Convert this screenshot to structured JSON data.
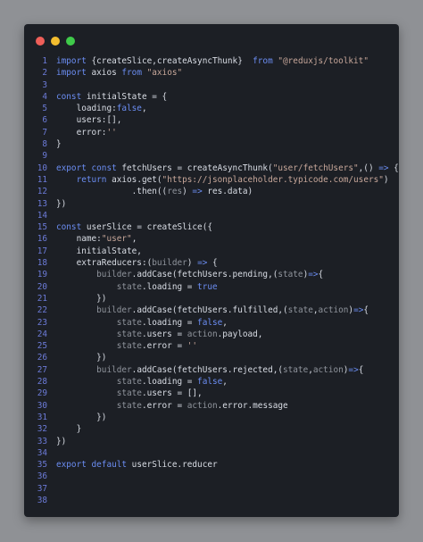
{
  "window": {
    "dots": [
      {
        "name": "close",
        "color": "#ef5f59"
      },
      {
        "name": "minimize",
        "color": "#f4bd2f"
      },
      {
        "name": "maximize",
        "color": "#3fca4a"
      }
    ]
  },
  "colors": {
    "keyword": "#6b8df2",
    "identifier": "#d9dde5",
    "string": "#c7a79a",
    "param": "#b5bac3",
    "line_number": "#6c7bd8",
    "background": "#1c1f25",
    "page_background": "#8f9195"
  },
  "code": {
    "lines": [
      {
        "n": "1",
        "tokens": [
          [
            "kw",
            "import "
          ],
          [
            "id",
            "{createSlice,createAsyncThunk}  "
          ],
          [
            "kw",
            "from "
          ],
          [
            "str",
            "\"@reduxjs/toolkit\""
          ]
        ]
      },
      {
        "n": "2",
        "tokens": [
          [
            "kw",
            "import "
          ],
          [
            "id",
            "axios "
          ],
          [
            "kw",
            "from "
          ],
          [
            "str",
            "\"axios\""
          ]
        ]
      },
      {
        "n": "3",
        "tokens": []
      },
      {
        "n": "4",
        "tokens": [
          [
            "kw",
            "const "
          ],
          [
            "id",
            "initialState = {"
          ]
        ]
      },
      {
        "n": "5",
        "tokens": [
          [
            "id",
            "    loading:"
          ],
          [
            "kw",
            "false"
          ],
          [
            "id",
            ","
          ]
        ]
      },
      {
        "n": "6",
        "tokens": [
          [
            "id",
            "    users:[],"
          ]
        ]
      },
      {
        "n": "7",
        "tokens": [
          [
            "id",
            "    error:"
          ],
          [
            "str",
            "''"
          ]
        ]
      },
      {
        "n": "8",
        "tokens": [
          [
            "id",
            "}"
          ]
        ]
      },
      {
        "n": "9",
        "tokens": []
      },
      {
        "n": "10",
        "tokens": [
          [
            "kw",
            "export const "
          ],
          [
            "id",
            "fetchUsers = createAsyncThunk("
          ],
          [
            "str",
            "\"user/fetchUsers\""
          ],
          [
            "id",
            ",() "
          ],
          [
            "kw",
            "=> "
          ],
          [
            "id",
            "{"
          ]
        ]
      },
      {
        "n": "11",
        "tokens": [
          [
            "kw",
            "    return "
          ],
          [
            "id",
            "axios.get("
          ],
          [
            "str",
            "\"https://jsonplaceholder.typicode.com/users\""
          ],
          [
            "id",
            ")"
          ]
        ]
      },
      {
        "n": "12",
        "tokens": [
          [
            "id",
            "               .then(("
          ],
          [
            "param",
            "res"
          ],
          [
            "id",
            ") "
          ],
          [
            "kw",
            "=> "
          ],
          [
            "id",
            "res.data)"
          ]
        ]
      },
      {
        "n": "13",
        "tokens": [
          [
            "id",
            "})"
          ]
        ]
      },
      {
        "n": "14",
        "tokens": []
      },
      {
        "n": "15",
        "tokens": [
          [
            "kw",
            "const "
          ],
          [
            "id",
            "userSlice = createSlice({"
          ]
        ]
      },
      {
        "n": "16",
        "tokens": [
          [
            "id",
            "    name:"
          ],
          [
            "str",
            "\"user\""
          ],
          [
            "id",
            ","
          ]
        ]
      },
      {
        "n": "17",
        "tokens": [
          [
            "id",
            "    initialState,"
          ]
        ]
      },
      {
        "n": "18",
        "tokens": [
          [
            "id",
            "    extraReducers:("
          ],
          [
            "param",
            "builder"
          ],
          [
            "id",
            ") "
          ],
          [
            "kw",
            "=> "
          ],
          [
            "id",
            "{"
          ]
        ]
      },
      {
        "n": "19",
        "tokens": [
          [
            "param",
            "        builder"
          ],
          [
            "id",
            ".addCase(fetchUsers.pending,("
          ],
          [
            "param",
            "state"
          ],
          [
            "id",
            ")"
          ],
          [
            "kw",
            "=>"
          ],
          [
            "id",
            "{"
          ]
        ]
      },
      {
        "n": "20",
        "tokens": [
          [
            "param",
            "            state"
          ],
          [
            "id",
            ".loading = "
          ],
          [
            "kw",
            "true"
          ]
        ]
      },
      {
        "n": "21",
        "tokens": [
          [
            "id",
            "        })"
          ]
        ]
      },
      {
        "n": "22",
        "tokens": [
          [
            "param",
            "        builder"
          ],
          [
            "id",
            ".addCase(fetchUsers.fulfilled,("
          ],
          [
            "param",
            "state"
          ],
          [
            "id",
            ","
          ],
          [
            "param",
            "action"
          ],
          [
            "id",
            ")"
          ],
          [
            "kw",
            "=>"
          ],
          [
            "id",
            "{"
          ]
        ]
      },
      {
        "n": "23",
        "tokens": [
          [
            "param",
            "            state"
          ],
          [
            "id",
            ".loading = "
          ],
          [
            "kw",
            "false"
          ],
          [
            "id",
            ","
          ]
        ]
      },
      {
        "n": "24",
        "tokens": [
          [
            "param",
            "            state"
          ],
          [
            "id",
            ".users = "
          ],
          [
            "param",
            "action"
          ],
          [
            "id",
            ".payload,"
          ]
        ]
      },
      {
        "n": "25",
        "tokens": [
          [
            "param",
            "            state"
          ],
          [
            "id",
            ".error = "
          ],
          [
            "str",
            "''"
          ]
        ]
      },
      {
        "n": "26",
        "tokens": [
          [
            "id",
            "        })"
          ]
        ]
      },
      {
        "n": "27",
        "tokens": [
          [
            "param",
            "        builder"
          ],
          [
            "id",
            ".addCase(fetchUsers.rejected,("
          ],
          [
            "param",
            "state"
          ],
          [
            "id",
            ","
          ],
          [
            "param",
            "action"
          ],
          [
            "id",
            ")"
          ],
          [
            "kw",
            "=>"
          ],
          [
            "id",
            "{"
          ]
        ]
      },
      {
        "n": "28",
        "tokens": [
          [
            "param",
            "            state"
          ],
          [
            "id",
            ".loading = "
          ],
          [
            "kw",
            "false"
          ],
          [
            "id",
            ","
          ]
        ]
      },
      {
        "n": "29",
        "tokens": [
          [
            "param",
            "            state"
          ],
          [
            "id",
            ".users = [],"
          ]
        ]
      },
      {
        "n": "30",
        "tokens": [
          [
            "param",
            "            state"
          ],
          [
            "id",
            ".error = "
          ],
          [
            "param",
            "action"
          ],
          [
            "id",
            ".error.message"
          ]
        ]
      },
      {
        "n": "31",
        "tokens": [
          [
            "id",
            "        })"
          ]
        ]
      },
      {
        "n": "32",
        "tokens": [
          [
            "id",
            "    }"
          ]
        ]
      },
      {
        "n": "33",
        "tokens": [
          [
            "id",
            "})"
          ]
        ]
      },
      {
        "n": "34",
        "tokens": []
      },
      {
        "n": "35",
        "tokens": [
          [
            "kw",
            "export default "
          ],
          [
            "id",
            "userSlice.reducer"
          ]
        ]
      },
      {
        "n": "36",
        "tokens": []
      },
      {
        "n": "37",
        "tokens": []
      },
      {
        "n": "38",
        "tokens": []
      }
    ]
  }
}
